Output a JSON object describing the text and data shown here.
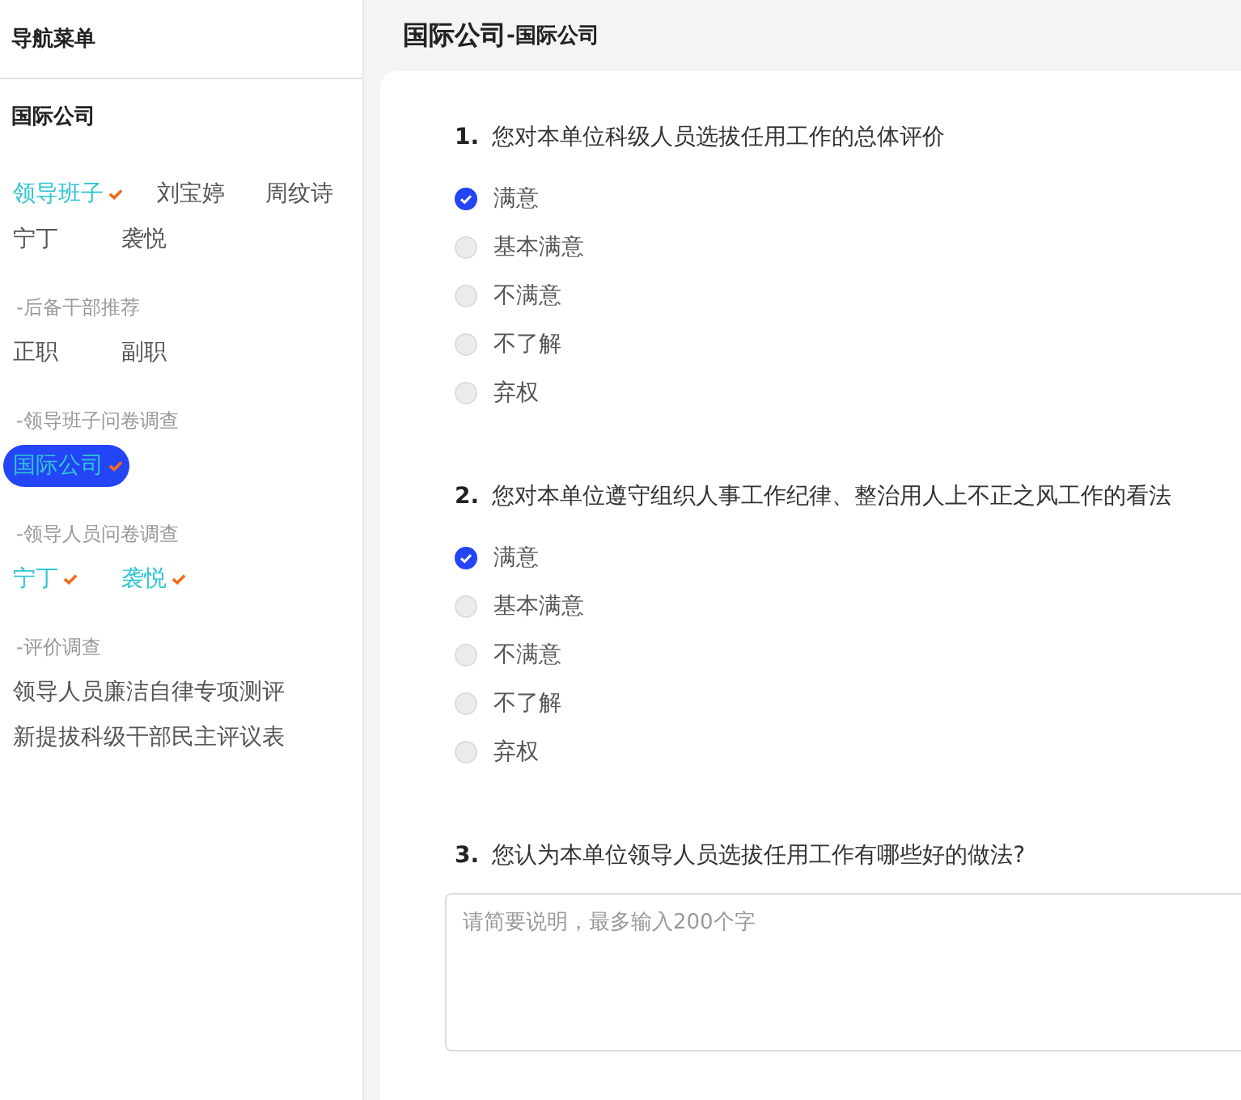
{
  "sidebar": {
    "title": "导航菜单",
    "company": "国际公司",
    "groups": [
      {
        "items": [
          {
            "label": "领导班子",
            "done": true,
            "selected": false
          },
          {
            "label": "刘宝婷",
            "done": false,
            "selected": false
          },
          {
            "label": "周纹诗",
            "done": false,
            "selected": false
          },
          {
            "label": "宁丁",
            "done": false,
            "selected": false
          },
          {
            "label": "袭悦",
            "done": false,
            "selected": false
          }
        ]
      },
      {
        "heading": "-后备干部推荐",
        "items": [
          {
            "label": "正职",
            "done": false,
            "selected": false
          },
          {
            "label": "副职",
            "done": false,
            "selected": false
          }
        ]
      },
      {
        "heading": "-领导班子问卷调查",
        "items": [
          {
            "label": "国际公司",
            "done": true,
            "selected": true
          }
        ]
      },
      {
        "heading": "-领导人员问卷调查",
        "items": [
          {
            "label": "宁丁",
            "done": true,
            "selected": false
          },
          {
            "label": "袭悦",
            "done": true,
            "selected": false
          }
        ]
      },
      {
        "heading": "-评价调查",
        "items": [
          {
            "label": "领导人员廉洁自律专项测评",
            "done": false,
            "selected": false
          },
          {
            "label": "新提拔科级干部民主评议表",
            "done": false,
            "selected": false
          }
        ]
      }
    ]
  },
  "page": {
    "title": "国际公司",
    "subtitle": "-国际公司"
  },
  "questions": [
    {
      "kind": "choice",
      "number": "1.",
      "text": "您对本单位科级人员选拔任用工作的总体评价",
      "options": [
        {
          "label": "满意",
          "selected": true
        },
        {
          "label": "基本满意",
          "selected": false
        },
        {
          "label": "不满意",
          "selected": false
        },
        {
          "label": "不了解",
          "selected": false
        },
        {
          "label": "弃权",
          "selected": false
        }
      ]
    },
    {
      "kind": "choice",
      "number": "2.",
      "text": "您对本单位遵守组织人事工作纪律、整治用人上不正之风工作的看法",
      "options": [
        {
          "label": "满意",
          "selected": true
        },
        {
          "label": "基本满意",
          "selected": false
        },
        {
          "label": "不满意",
          "selected": false
        },
        {
          "label": "不了解",
          "selected": false
        },
        {
          "label": "弃权",
          "selected": false
        }
      ]
    },
    {
      "kind": "text",
      "number": "3.",
      "text": "您认为本单位领导人员选拔任用工作有哪些好的做法?",
      "placeholder": "请简要说明，最多输入200个字"
    }
  ]
}
